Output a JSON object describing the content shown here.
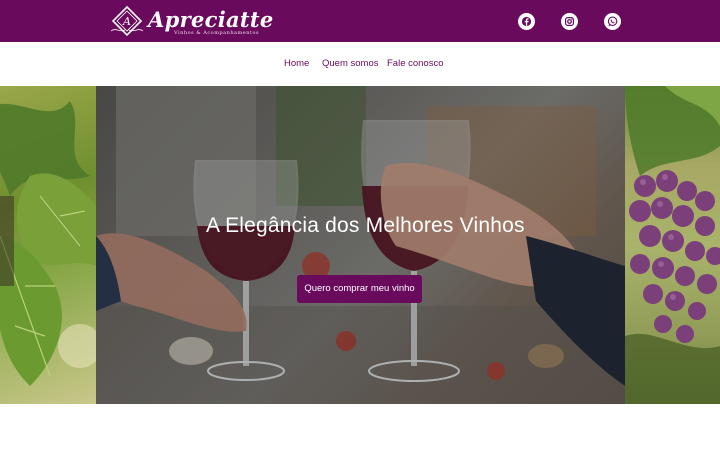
{
  "brand": {
    "name": "Apreciatte",
    "tagline": "Vinhos & Acompanhamentos",
    "color": "#6a0a5c"
  },
  "social": [
    {
      "icon": "facebook-icon"
    },
    {
      "icon": "instagram-icon"
    },
    {
      "icon": "whatsapp-icon"
    }
  ],
  "nav": {
    "items": [
      {
        "label": "Home"
      },
      {
        "label": "Quem somos"
      },
      {
        "label": "Fale conosco"
      }
    ]
  },
  "hero": {
    "title": "A Elegância dos Melhores Vinhos",
    "cta_label": "Quero comprar meu vinho",
    "images": [
      "grape-vine-leaves",
      "two-glasses-red-wine-toast",
      "purple-grape-cluster"
    ]
  }
}
